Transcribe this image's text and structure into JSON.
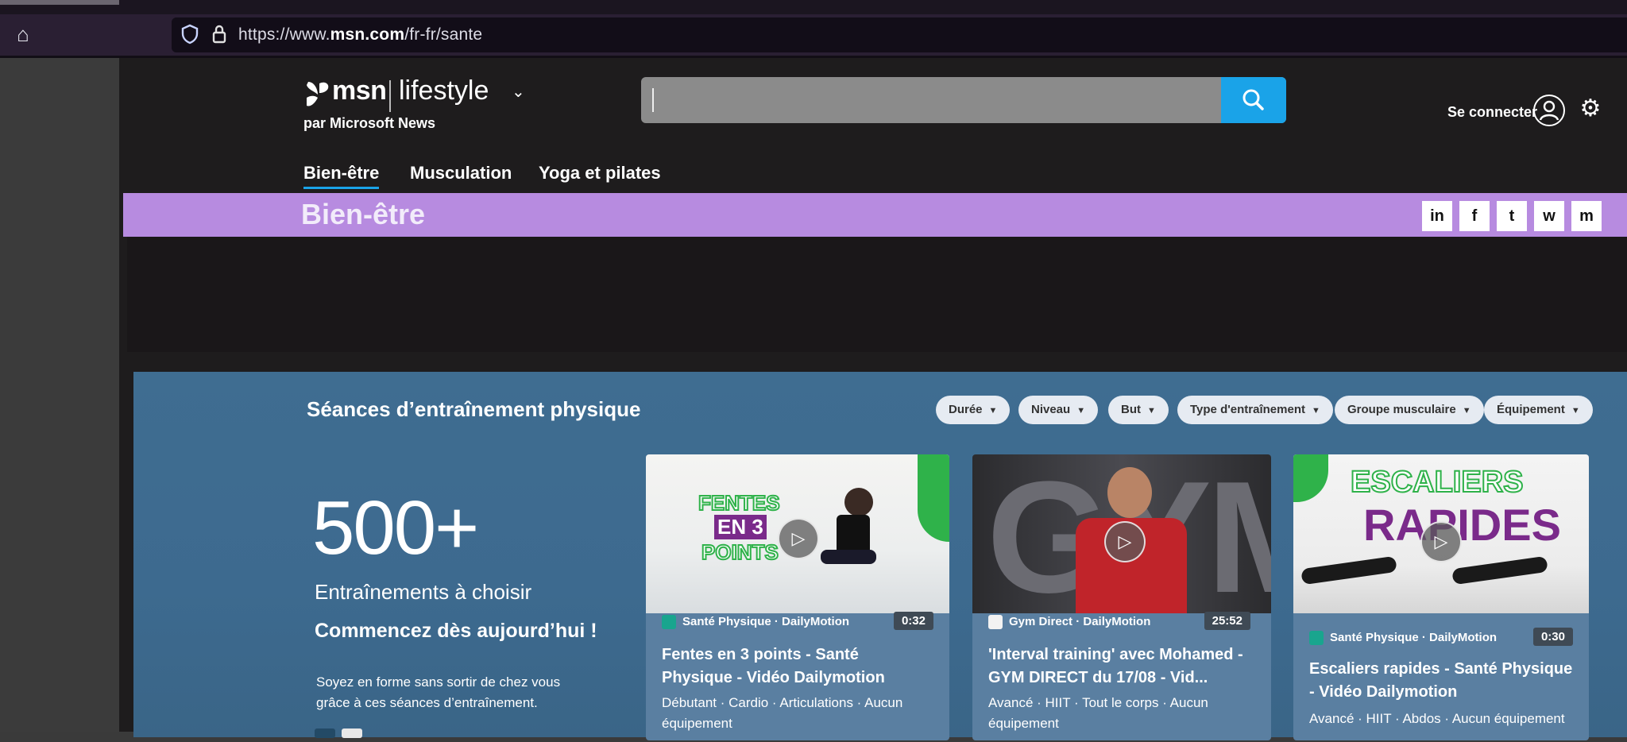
{
  "browser": {
    "url_prefix": "https://www.",
    "url_domain": "msn.com",
    "url_path": "/fr-fr/sante"
  },
  "header": {
    "brand": "msn",
    "section": "lifestyle",
    "byline": "par Microsoft News",
    "signin": "Se connecter"
  },
  "subnav": [
    "Bien-être",
    "Musculation",
    "Yoga et pilates"
  ],
  "banner": {
    "title": "Bien-être"
  },
  "share": [
    "in",
    "f",
    "t",
    "w",
    "m"
  ],
  "workouts": {
    "heading": "Séances d’entraînement physique",
    "filters": [
      "Durée",
      "Niveau",
      "But",
      "Type d'entraînement",
      "Groupe musculaire",
      "Équipement"
    ],
    "count": "500+",
    "count_label": "Entraînements à choisir",
    "cta": "Commencez dès aujourd’hui !",
    "desc1": "Soyez en forme sans sortir de chez vous",
    "desc2": "grâce à ces séances d’entraînement.",
    "cards": [
      {
        "source": "Santé Physique · DailyMotion",
        "duration": "0:32",
        "title": "Fentes en 3 points - Santé Physique - Vidéo Dailymotion",
        "tags": "Débutant · Cardio · Articulations · Aucun équipement",
        "thumb_text_1": "FENTES",
        "thumb_text_2": "EN 3",
        "thumb_text_3": "POINTS"
      },
      {
        "source": "Gym Direct · DailyMotion",
        "duration": "25:52",
        "title": "'Interval training' avec Mohamed - GYM DIRECT du 17/08 - Vid...",
        "tags": "Avancé · HIIT · Tout le corps · Aucun équipement",
        "thumb_text_1": "GYM"
      },
      {
        "source": "Santé Physique · DailyMotion",
        "duration": "0:30",
        "title": "Escaliers rapides - Santé Physique - Vidéo Dailymotion",
        "tags": "Avancé · HIIT · Abdos · Aucun équipement",
        "thumb_text_1": "ESCALIERS",
        "thumb_text_2": "RAPIDES"
      }
    ]
  },
  "colors": {
    "accent": "#1aa3e8",
    "banner": "#b78be0",
    "section_bg": "#3f6d91"
  }
}
